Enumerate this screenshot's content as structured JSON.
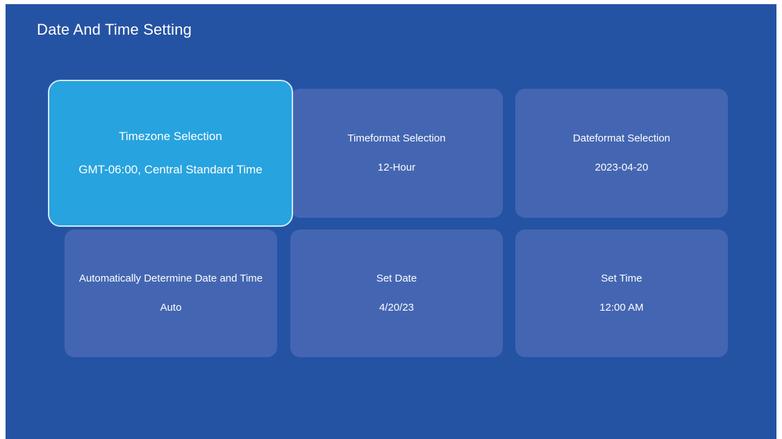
{
  "header": {
    "title": "Date And Time Setting"
  },
  "settings": {
    "timezone": {
      "label": "Timezone Selection",
      "value": "GMT-06:00, Central Standard Time"
    },
    "timeformat": {
      "label": "Timeformat Selection",
      "value": "12-Hour"
    },
    "dateformat": {
      "label": "Dateformat Selection",
      "value": "2023-04-20"
    },
    "auto": {
      "label": "Automatically Determine Date and Time",
      "value": "Auto"
    },
    "set_date": {
      "label": "Set Date",
      "value": "4/20/23"
    },
    "set_time": {
      "label": "Set Time",
      "value": "12:00 AM"
    }
  },
  "focused_item": "Timezone Selection",
  "colors": {
    "background": "#2553a3",
    "card": "#4466b2",
    "focused_card": "#27a3df",
    "focused_border": "#cfe8f8",
    "text": "#ffffff"
  }
}
